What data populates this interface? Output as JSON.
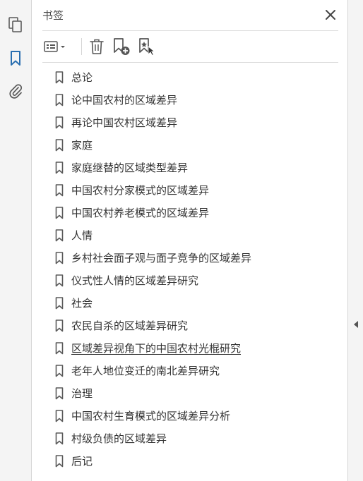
{
  "rail": {
    "items": [
      {
        "icon": "pages-icon",
        "active": false
      },
      {
        "icon": "bookmark-icon",
        "active": true
      },
      {
        "icon": "attachment-icon",
        "active": false
      }
    ]
  },
  "panel": {
    "title": "书签",
    "toolbar": {
      "icons": [
        "options-menu-icon",
        "delete-icon",
        "new-bookmark-icon",
        "bookmark-from-selection-icon"
      ]
    }
  },
  "bookmarks": [
    {
      "label": "总论"
    },
    {
      "label": "论中国农村的区域差异"
    },
    {
      "label": "再论中国农村区域差异"
    },
    {
      "label": "家庭"
    },
    {
      "label": "家庭继替的区域类型差异"
    },
    {
      "label": "中国农村分家模式的区域差异"
    },
    {
      "label": "中国农村养老模式的区域差异"
    },
    {
      "label": "人情"
    },
    {
      "label": "乡村社会面子观与面子竞争的区域差异"
    },
    {
      "label": "仪式性人情的区域差异研究"
    },
    {
      "label": "社会"
    },
    {
      "label": "农民自杀的区域差异研究"
    },
    {
      "label": "区域差异视角下的中国农村光棍研究",
      "hovered": true
    },
    {
      "label": "老年人地位变迁的南北差异研究"
    },
    {
      "label": "治理"
    },
    {
      "label": "中国农村生育模式的区域差异分析"
    },
    {
      "label": "村级负债的区域差异"
    },
    {
      "label": "后记"
    }
  ],
  "colors": {
    "accent": "#2a6fb0",
    "icon": "#5a5a5a",
    "text": "#333333"
  }
}
